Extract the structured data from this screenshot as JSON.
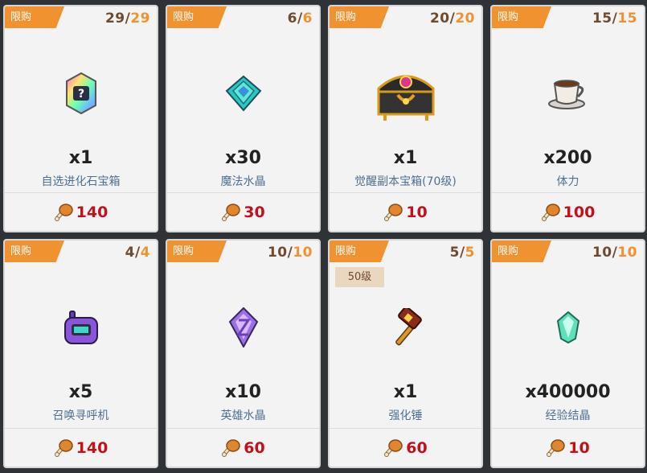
{
  "colors": {
    "tag": "#f0922f",
    "stock_current": "#6e4a2f",
    "stock_max": "#f0922f",
    "name": "#4f6f92",
    "price": "#c1121b"
  },
  "shop": {
    "items": [
      {
        "tag": "限购",
        "stock_current": "29",
        "stock_slash": "/",
        "stock_max": "29",
        "quantity": "x1",
        "name": "自选进化石宝箱",
        "price": "140",
        "icon": "rainbow-evolution-stone-chest-icon",
        "price_icon": "drumstick-icon"
      },
      {
        "tag": "限购",
        "stock_current": "6",
        "stock_slash": "/",
        "stock_max": "6",
        "quantity": "x30",
        "name": "魔法水晶",
        "price": "30",
        "icon": "magic-crystal-icon",
        "price_icon": "drumstick-icon"
      },
      {
        "tag": "限购",
        "stock_current": "20",
        "stock_slash": "/",
        "stock_max": "20",
        "quantity": "x1",
        "name": "觉醒副本宝箱(70级)",
        "price": "10",
        "icon": "treasure-chest-icon",
        "price_icon": "drumstick-icon"
      },
      {
        "tag": "限购",
        "stock_current": "15",
        "stock_slash": "/",
        "stock_max": "15",
        "quantity": "x200",
        "name": "体力",
        "price": "100",
        "icon": "coffee-cup-icon",
        "price_icon": "drumstick-icon"
      },
      {
        "tag": "限购",
        "stock_current": "4",
        "stock_slash": "/",
        "stock_max": "4",
        "quantity": "x5",
        "name": "召唤寻呼机",
        "price": "140",
        "icon": "pager-icon",
        "price_icon": "drumstick-icon"
      },
      {
        "tag": "限购",
        "stock_current": "10",
        "stock_slash": "/",
        "stock_max": "10",
        "quantity": "x10",
        "name": "英雄水晶",
        "price": "60",
        "icon": "hero-crystal-icon",
        "price_icon": "drumstick-icon"
      },
      {
        "tag": "限购",
        "stock_current": "5",
        "stock_slash": "/",
        "stock_max": "5",
        "level_badge": "50级",
        "quantity": "x1",
        "name": "强化锤",
        "price": "60",
        "icon": "hammer-icon",
        "price_icon": "drumstick-icon"
      },
      {
        "tag": "限购",
        "stock_current": "10",
        "stock_slash": "/",
        "stock_max": "10",
        "quantity": "x400000",
        "name": "经验结晶",
        "price": "10",
        "icon": "exp-crystal-icon",
        "price_icon": "drumstick-icon"
      }
    ]
  }
}
